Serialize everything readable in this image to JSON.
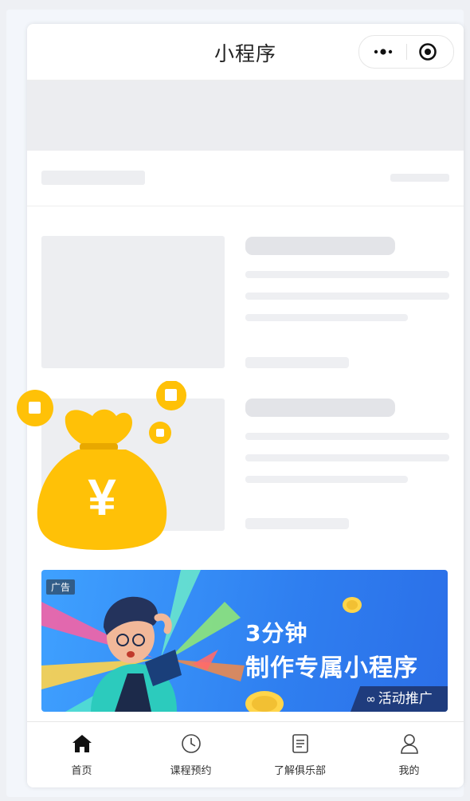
{
  "nav": {
    "title": "小程序",
    "more_icon": "more-dots-icon",
    "close_icon": "target-close-icon"
  },
  "ad": {
    "tag": "广告",
    "line1": "3分钟",
    "line2": "制作专属小程序",
    "promo_label": "活动推广",
    "promo_icon": "link-icon",
    "bg_color": "#3a8ef6"
  },
  "float_widget": {
    "icon": "money-bag-yuan-icon",
    "symbol": "¥",
    "color": "#ffc107"
  },
  "tabs": [
    {
      "label": "首页",
      "icon": "home-icon",
      "active": true
    },
    {
      "label": "课程预约",
      "icon": "clock-icon",
      "active": false
    },
    {
      "label": "了解俱乐部",
      "icon": "document-icon",
      "active": false
    },
    {
      "label": "我的",
      "icon": "user-icon",
      "active": false
    }
  ]
}
